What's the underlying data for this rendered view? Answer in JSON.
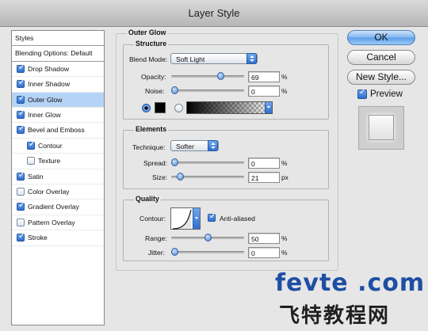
{
  "window": {
    "title": "Layer Style"
  },
  "styles_list": {
    "header": "Styles",
    "blending": "Blending Options: Default",
    "items": [
      {
        "label": "Drop Shadow",
        "checked": true,
        "indent": false,
        "selected": false
      },
      {
        "label": "Inner Shadow",
        "checked": true,
        "indent": false,
        "selected": false
      },
      {
        "label": "Outer Glow",
        "checked": true,
        "indent": false,
        "selected": true
      },
      {
        "label": "Inner Glow",
        "checked": true,
        "indent": false,
        "selected": false
      },
      {
        "label": "Bevel and Emboss",
        "checked": true,
        "indent": false,
        "selected": false
      },
      {
        "label": "Contour",
        "checked": true,
        "indent": true,
        "selected": false
      },
      {
        "label": "Texture",
        "checked": false,
        "indent": true,
        "selected": false
      },
      {
        "label": "Satin",
        "checked": true,
        "indent": false,
        "selected": false
      },
      {
        "label": "Color Overlay",
        "checked": false,
        "indent": false,
        "selected": false
      },
      {
        "label": "Gradient Overlay",
        "checked": true,
        "indent": false,
        "selected": false
      },
      {
        "label": "Pattern Overlay",
        "checked": false,
        "indent": false,
        "selected": false
      },
      {
        "label": "Stroke",
        "checked": true,
        "indent": false,
        "selected": false
      }
    ]
  },
  "outer_glow": {
    "title": "Outer Glow",
    "structure": {
      "title": "Structure",
      "blend_mode_label": "Blend Mode:",
      "blend_mode_value": "Soft Light",
      "opacity_label": "Opacity:",
      "opacity_value": "69",
      "opacity_unit": "%",
      "opacity_fraction": 0.69,
      "noise_label": "Noise:",
      "noise_value": "0",
      "noise_unit": "%",
      "noise_fraction": 0.0,
      "color_swatch": "#000000",
      "solid_selected": true
    },
    "elements": {
      "title": "Elements",
      "technique_label": "Technique:",
      "technique_value": "Softer",
      "spread_label": "Spread:",
      "spread_value": "0",
      "spread_unit": "%",
      "spread_fraction": 0.0,
      "size_label": "Size:",
      "size_value": "21",
      "size_unit": "px",
      "size_fraction": 0.085
    },
    "quality": {
      "title": "Quality",
      "contour_label": "Contour:",
      "anti_aliased_label": "Anti-aliased",
      "anti_aliased_checked": true,
      "range_label": "Range:",
      "range_value": "50",
      "range_unit": "%",
      "range_fraction": 0.5,
      "jitter_label": "Jitter:",
      "jitter_value": "0",
      "jitter_unit": "%",
      "jitter_fraction": 0.0
    }
  },
  "buttons": {
    "ok": "OK",
    "cancel": "Cancel",
    "new_style": "New Style..."
  },
  "preview": {
    "label": "Preview",
    "checked": true
  },
  "watermark": {
    "line1": "fevte .com",
    "line2": "飞特教程网"
  },
  "colors": {
    "accent": "#3b7fd9",
    "selected_row": "#b5d3f5"
  }
}
